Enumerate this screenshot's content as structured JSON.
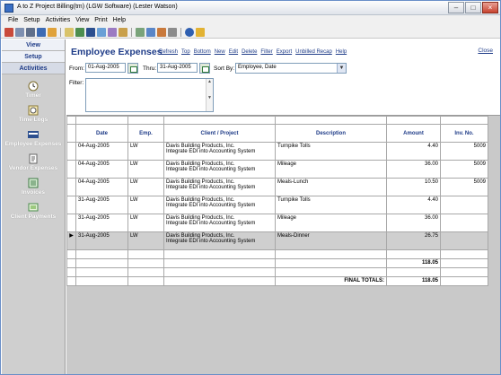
{
  "window": {
    "title": "A to Z Project Billing(tm)  (LGW Software)  (Lester Watson)"
  },
  "menu": [
    "File",
    "Setup",
    "Activities",
    "View",
    "Print",
    "Help"
  ],
  "toolbar": {
    "icons": [
      "exit-icon",
      "edit-icon",
      "print-icon",
      "user-icon",
      "tools-icon",
      "time-icon",
      "calendar-icon",
      "expenses-icon",
      "invoice-icon",
      "payment-icon",
      "home-icon",
      "list-icon",
      "report-icon",
      "chart-icon",
      "window-icon",
      "help-icon",
      "info-icon"
    ]
  },
  "sidebar": {
    "tabs": [
      "View",
      "Setup",
      "Activities"
    ],
    "items": [
      {
        "label": "Timer",
        "icon": "timer-icon"
      },
      {
        "label": "Time Logs",
        "icon": "time-logs-icon"
      },
      {
        "label": "Employee Expenses",
        "icon": "employee-expenses-icon"
      },
      {
        "label": "Vendor Expenses",
        "icon": "vendor-expenses-icon"
      },
      {
        "label": "Invoices",
        "icon": "invoices-icon"
      },
      {
        "label": "Client Payments",
        "icon": "client-payments-icon"
      }
    ]
  },
  "page": {
    "title": "Employee Expenses",
    "links": [
      "Refresh",
      "Top",
      "Bottom",
      "New",
      "Edit",
      "Delete",
      "Filter",
      "Export",
      "Unbilled Recap",
      "Help"
    ],
    "close": "Close"
  },
  "filters": {
    "from_label": "From:",
    "from_value": "01-Aug-2005",
    "thru_label": "Thru:",
    "thru_value": "31-Aug-2005",
    "sort_label": "Sort By:",
    "sort_value": "Employee, Date",
    "filter_label": "Filter:",
    "filter_value": ""
  },
  "table": {
    "columns": [
      "Date",
      "Emp.",
      "Client / Project",
      "Description",
      "Amount",
      "Inv. No."
    ],
    "rows": [
      {
        "date": "04-Aug-2005",
        "emp": "LW",
        "client": "Davis Building Products, Inc.",
        "project": "Integrate EDI into Accounting System",
        "description": "Turnpike Tolls",
        "amount": "4.40",
        "inv": "5009"
      },
      {
        "date": "04-Aug-2005",
        "emp": "LW",
        "client": "Davis Building Products, Inc.",
        "project": "Integrate EDI into Accounting System",
        "description": "Mileage",
        "amount": "36.00",
        "inv": "5009"
      },
      {
        "date": "04-Aug-2005",
        "emp": "LW",
        "client": "Davis Building Products, Inc.",
        "project": "Integrate EDI into Accounting System",
        "description": "Meals-Lunch",
        "amount": "10.50",
        "inv": "5009"
      },
      {
        "date": "31-Aug-2005",
        "emp": "LW",
        "client": "Davis Building Products, Inc.",
        "project": "Integrate EDI into Accounting System",
        "description": "Turnpike Tolls",
        "amount": "4.40",
        "inv": ""
      },
      {
        "date": "31-Aug-2005",
        "emp": "LW",
        "client": "Davis Building Products, Inc.",
        "project": "Integrate EDI into Accounting System",
        "description": "Mileage",
        "amount": "36.00",
        "inv": ""
      },
      {
        "date": "31-Aug-2005",
        "emp": "LW",
        "client": "Davis Building Products, Inc.",
        "project": "Integrate EDI into Accounting System",
        "description": "Meals-Dinner",
        "amount": "26.75",
        "inv": ""
      }
    ],
    "selected_index": 5,
    "subtotal": "118.05",
    "final_label": "FINAL TOTALS:",
    "final_total": "118.05"
  }
}
